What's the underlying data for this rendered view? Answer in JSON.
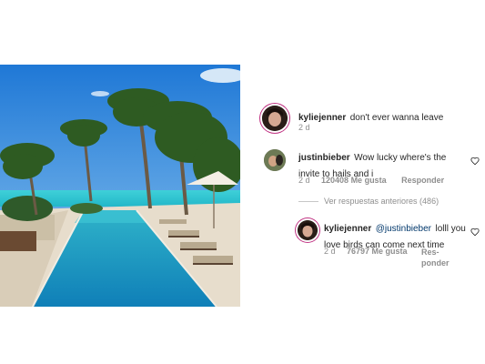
{
  "comments": [
    {
      "username": "kyliejenner",
      "text": "don't ever wanna leave",
      "time": "2 d"
    },
    {
      "username": "justinbieber",
      "text": "Wow lucky where's the invite to hails and i",
      "time": "2 d",
      "likes": "120408 Me gusta",
      "reply_label": "Responder"
    }
  ],
  "view_replies_label": "Ver respuestas anteriores (486)",
  "reply": {
    "username": "kyliejenner",
    "mention": "@justinbieber",
    "text": "lolll you love birds can come next time",
    "time": "2 d",
    "likes": "76797 Me gusta",
    "reply_label_line1": "Res-",
    "reply_label_line2": "ponder"
  },
  "icons": {
    "like": "heart-icon",
    "avatar": "avatar"
  }
}
